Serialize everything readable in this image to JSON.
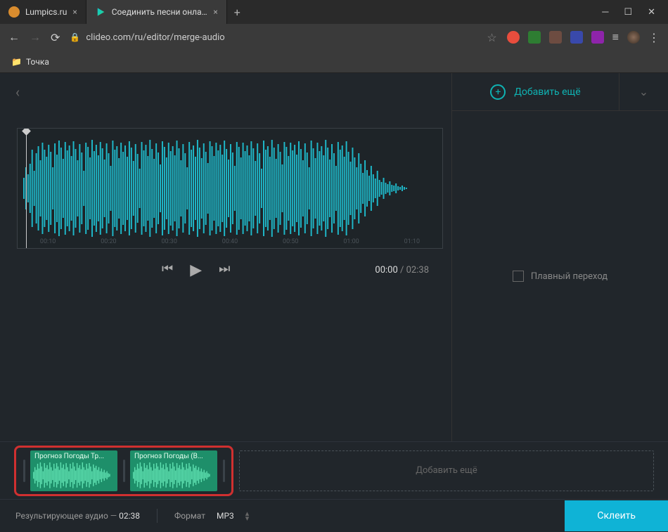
{
  "browser": {
    "tabs": [
      {
        "title": "Lumpics.ru",
        "favicon": "#d98c2e",
        "active": false
      },
      {
        "title": "Соединить песни онлайн — Со...",
        "favicon": "play",
        "active": true
      }
    ],
    "url": "clideo.com/ru/editor/merge-audio",
    "bookmark_folder": "Точка",
    "ext_colors": [
      "#e84d3d",
      "#2e7d32",
      "#6d4c41",
      "#3949ab",
      "#0288d1",
      "#00838f",
      "#8e24aa"
    ]
  },
  "app": {
    "add_more_label": "Добавить ещё",
    "crossfade_label": "Плавный переход",
    "time_current": "00:00",
    "time_total": "02:38",
    "ruler": [
      "00:10",
      "00:20",
      "00:30",
      "00:40",
      "00:50",
      "01:00",
      "01:10"
    ],
    "clips": [
      {
        "label": "Прогноз Погоды Тр..."
      },
      {
        "label": "Прогноз Погоды (В..."
      }
    ],
    "add_clip_label": "Добавить ещё",
    "result_label": "Результирующее аудио",
    "result_value": "02:38",
    "format_label": "Формат",
    "format_value": "MP3",
    "merge_label": "Склеить"
  }
}
